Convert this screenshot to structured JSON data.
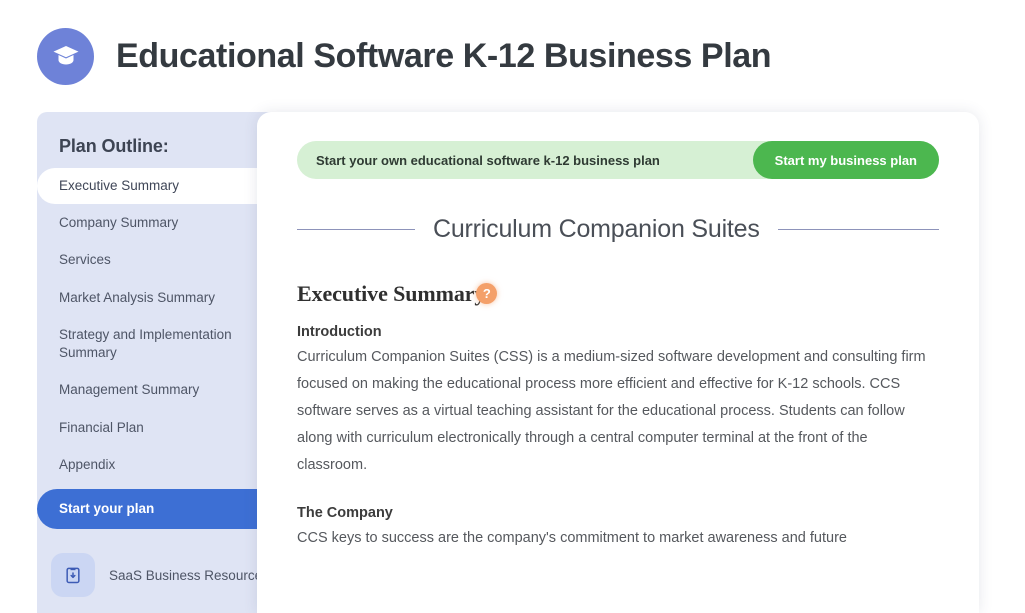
{
  "header": {
    "title": "Educational Software K-12 Business Plan",
    "logo_icon": "graduation-cap-icon",
    "logo_color": "#6e82d8"
  },
  "sidebar": {
    "title": "Plan Outline:",
    "background_color": "#dfe4f4",
    "items": [
      {
        "label": "Executive Summary",
        "active": true
      },
      {
        "label": "Company Summary",
        "active": false
      },
      {
        "label": "Services",
        "active": false
      },
      {
        "label": "Market Analysis Summary",
        "active": false
      },
      {
        "label": "Strategy and Implementation Summary",
        "active": false
      },
      {
        "label": "Management Summary",
        "active": false
      },
      {
        "label": "Financial Plan",
        "active": false
      },
      {
        "label": "Appendix",
        "active": false
      }
    ],
    "cta": {
      "label": "Start your plan",
      "color": "#3d6fd4"
    },
    "resource": {
      "label": "SaaS Business Resources",
      "icon": "clipboard-download-icon",
      "icon_background": "#cbd6f3"
    }
  },
  "content": {
    "banner": {
      "text": "Start your own educational software k-12 business plan",
      "button_label": "Start my business plan",
      "background_color": "#d6f0d4",
      "button_color": "#4cb74f"
    },
    "document_title": "Curriculum Companion Suites",
    "section": {
      "heading": "Executive Summary",
      "help_badge": "?",
      "help_badge_color": "#f4a06a"
    },
    "blocks": [
      {
        "subheading": "Introduction",
        "paragraph": "Curriculum Companion Suites (CSS) is a medium-sized software development and consulting firm focused on making the educational process more efficient and effective for K-12 schools. CCS software serves as a virtual teaching assistant for the educational process. Students can follow along with curriculum electronically through a central computer terminal at the front of the classroom."
      },
      {
        "subheading": "The Company",
        "paragraph": "CCS keys to success are the company's commitment to market awareness and future"
      }
    ]
  }
}
